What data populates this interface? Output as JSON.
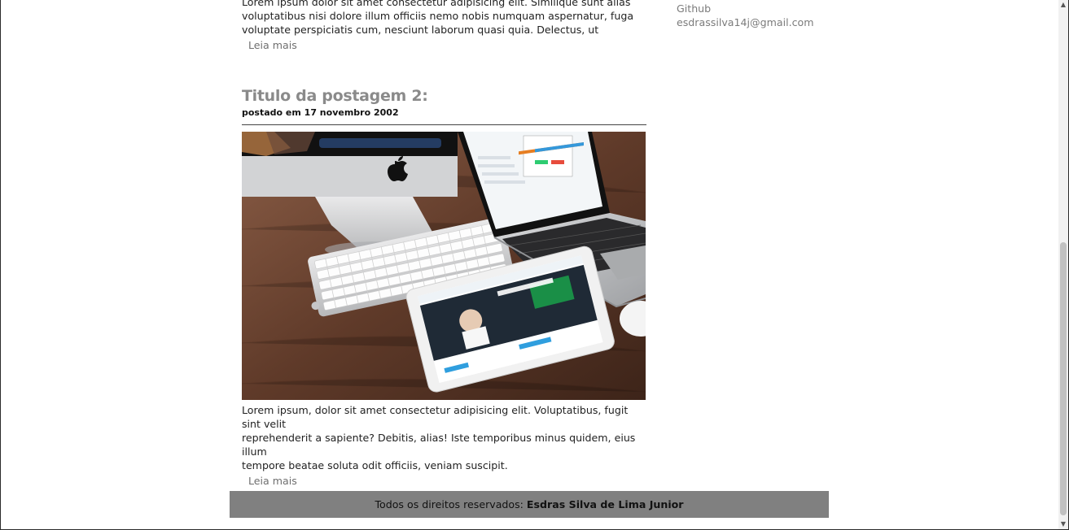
{
  "post1": {
    "text_lines": [
      "Lorem ipsum dolor sit amet consectetur adipisicing elit. Similique sunt alias",
      "voluptatibus nisi dolore illum officiis nemo nobis numquam aspernatur, fuga",
      "voluptate perspiciatis cum, nesciunt laborum quasi quia. Delectus, ut"
    ],
    "read_more": "Leia mais"
  },
  "sidebar": {
    "github": "Github",
    "email": "esdrassilva14j@gmail.com"
  },
  "post2": {
    "title": "Titulo da postagem 2:",
    "date": "postado em 17 novembro 2002",
    "image_alt": "workspace-desk-photo",
    "text_lines": [
      "Lorem ipsum, dolor sit amet consectetur adipisicing elit. Voluptatibus, fugit sint velit",
      "reprehenderit a sapiente? Debitis, alias! Iste temporibus minus quidem, eius illum",
      "tempore beatae soluta odit officiis, veniam suscipit."
    ],
    "read_more": "Leia mais"
  },
  "footer": {
    "prefix": "Todos os direitos reservados:",
    "author": "Esdras Silva de Lima Junior"
  },
  "scrollbar": {
    "up_icon": "triangle-up-icon",
    "down_icon": "triangle-down-icon"
  }
}
